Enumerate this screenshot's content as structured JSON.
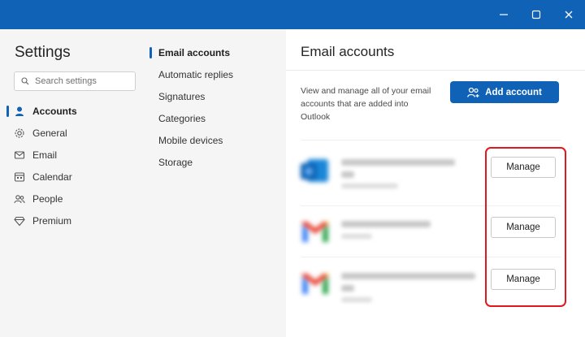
{
  "window": {
    "controls": {
      "minimize": "minimize-icon",
      "maximize": "maximize-icon",
      "close": "close-icon"
    },
    "titlebar_color": "#0f62b5"
  },
  "settings": {
    "title": "Settings",
    "search": {
      "placeholder": "Search settings",
      "icon": "search-icon"
    },
    "nav": [
      {
        "label": "Accounts",
        "icon": "person-icon",
        "active": true
      },
      {
        "label": "General",
        "icon": "gear-icon",
        "active": false
      },
      {
        "label": "Email",
        "icon": "mail-icon",
        "active": false
      },
      {
        "label": "Calendar",
        "icon": "calendar-icon",
        "active": false
      },
      {
        "label": "People",
        "icon": "people-icon",
        "active": false
      },
      {
        "label": "Premium",
        "icon": "diamond-icon",
        "active": false
      }
    ],
    "subnav": [
      {
        "label": "Email accounts",
        "active": true
      },
      {
        "label": "Automatic replies",
        "active": false
      },
      {
        "label": "Signatures",
        "active": false
      },
      {
        "label": "Categories",
        "active": false
      },
      {
        "label": "Mobile devices",
        "active": false
      },
      {
        "label": "Storage",
        "active": false
      }
    ]
  },
  "content": {
    "title": "Email accounts",
    "description": "View and manage all of your email accounts that are added into Outlook",
    "add_account_label": "Add account",
    "add_account_icon": "add-person-icon",
    "accounts": [
      {
        "provider_icon": "outlook-icon",
        "manage_label": "Manage"
      },
      {
        "provider_icon": "gmail-icon",
        "manage_label": "Manage"
      },
      {
        "provider_icon": "gmail-icon",
        "manage_label": "Manage"
      }
    ],
    "highlight_color": "#e0191e"
  }
}
